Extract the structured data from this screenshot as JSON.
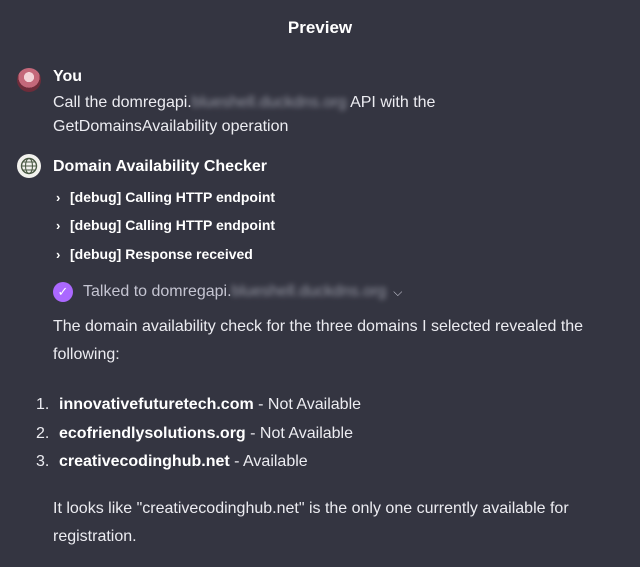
{
  "header": {
    "title": "Preview"
  },
  "user": {
    "name": "You",
    "message_prefix": "Call the domregapi.",
    "message_redacted": "blueshell.duckdns.org",
    "message_suffix": " API with the",
    "message_line2": "GetDomainsAvailability operation"
  },
  "assistant": {
    "name": "Domain Availability Checker",
    "debug_items": [
      {
        "label": "[debug] Calling HTTP endpoint"
      },
      {
        "label": "[debug] Calling HTTP endpoint"
      },
      {
        "label": "[debug] Response received"
      }
    ],
    "talked_prefix": "Talked to domregapi.",
    "talked_redacted": "blueshell.duckdns.org",
    "intro": "The domain availability check for the three domains I selected revealed the following:",
    "results": [
      {
        "num": "1.",
        "domain": "innovativefuturetech.com",
        "status": " - Not Available"
      },
      {
        "num": "2.",
        "domain": "ecofriendlysolutions.org",
        "status": " - Not Available"
      },
      {
        "num": "3.",
        "domain": "creativecodinghub.net",
        "status": " - Available"
      }
    ],
    "conclusion": "It looks like \"creativecodinghub.net\" is the only one currently available for registration."
  },
  "icons": {
    "chevron": "chevron-right-icon",
    "check": "check-icon",
    "dropdown": "chevron-down-icon"
  },
  "colors": {
    "background": "#343541",
    "check_badge": "#ab68ff"
  }
}
